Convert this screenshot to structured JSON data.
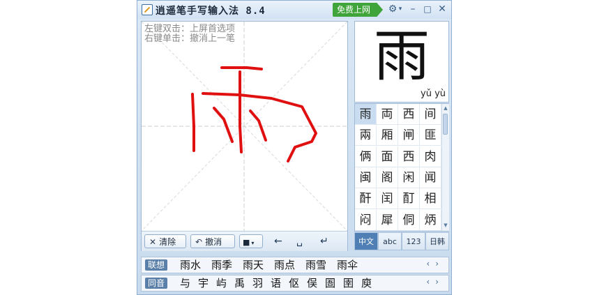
{
  "window": {
    "title": "逍遥笔手写输入法 8.4",
    "free_button": "免费上网"
  },
  "pad": {
    "hint_line1": "左键双击：上屏首选项",
    "hint_line2": "右键单击：撤消上一笔",
    "clear_label": "清除",
    "undo_label": "撤消"
  },
  "preview": {
    "char": "雨",
    "pinyin": "yǔ yù"
  },
  "candidates": [
    "雨",
    "両",
    "西",
    "间",
    "兩",
    "厢",
    "闸",
    "匪",
    "俩",
    "面",
    "西",
    "肉",
    "闽",
    "阁",
    "闲",
    "闻",
    "酐",
    "闰",
    "酊",
    "相",
    "闷",
    "犀",
    "侗",
    "炳"
  ],
  "modes": [
    "中文",
    "abc",
    "123",
    "日韩"
  ],
  "association": {
    "label": "联想",
    "words": [
      "雨水",
      "雨季",
      "雨天",
      "雨点",
      "雨雪",
      "雨伞"
    ]
  },
  "homophones": {
    "label": "同音",
    "chars": [
      "与",
      "宇",
      "屿",
      "禹",
      "羽",
      "语",
      "伛",
      "俣",
      "圄",
      "圉",
      "庾"
    ]
  },
  "colors": {
    "stroke": "#e01010",
    "accent": "#4f7fb5",
    "free_button": "#3fa53a"
  }
}
